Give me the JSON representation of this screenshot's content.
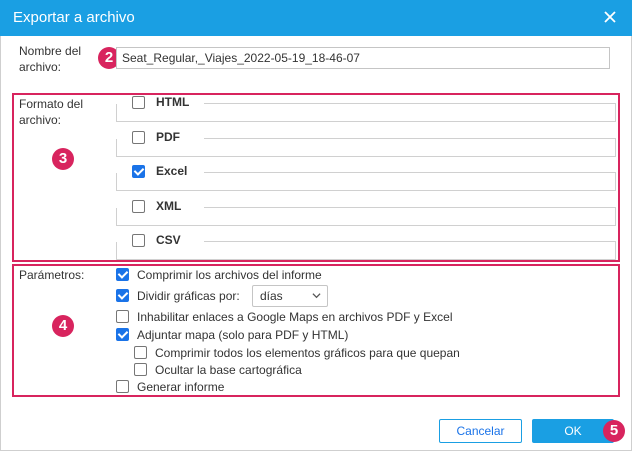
{
  "dialog": {
    "title": "Exportar a archivo"
  },
  "filename": {
    "label": "Nombre del archivo:",
    "value": "Seat_Regular,_Viajes_2022-05-19_18-46-07"
  },
  "format": {
    "label": "Formato del archivo:",
    "options": [
      {
        "label": "HTML",
        "checked": false
      },
      {
        "label": "PDF",
        "checked": false
      },
      {
        "label": "Excel",
        "checked": true
      },
      {
        "label": "XML",
        "checked": false
      },
      {
        "label": "CSV",
        "checked": false
      }
    ]
  },
  "params": {
    "label": "Parámetros:",
    "compress_reports": "Comprimir los archivos del informe",
    "split_charts": "Dividir gráficas por:",
    "split_value": "días",
    "disable_links": "Inhabilitar enlaces a Google Maps en archivos PDF y Excel",
    "attach_map": "Adjuntar mapa (solo para PDF y HTML)",
    "compress_graphics": "Comprimir todos los elementos gráficos para que quepan",
    "hide_base": "Ocultar la base cartográfica",
    "generate_report": "Generar informe"
  },
  "buttons": {
    "cancel": "Cancelar",
    "ok": "OK"
  },
  "badges": {
    "b2": "2",
    "b3": "3",
    "b4": "4",
    "b5": "5"
  },
  "colors": {
    "titlebar": "#1a9fe3",
    "highlight": "#d8245e",
    "checkbox": "#1a73e8"
  }
}
